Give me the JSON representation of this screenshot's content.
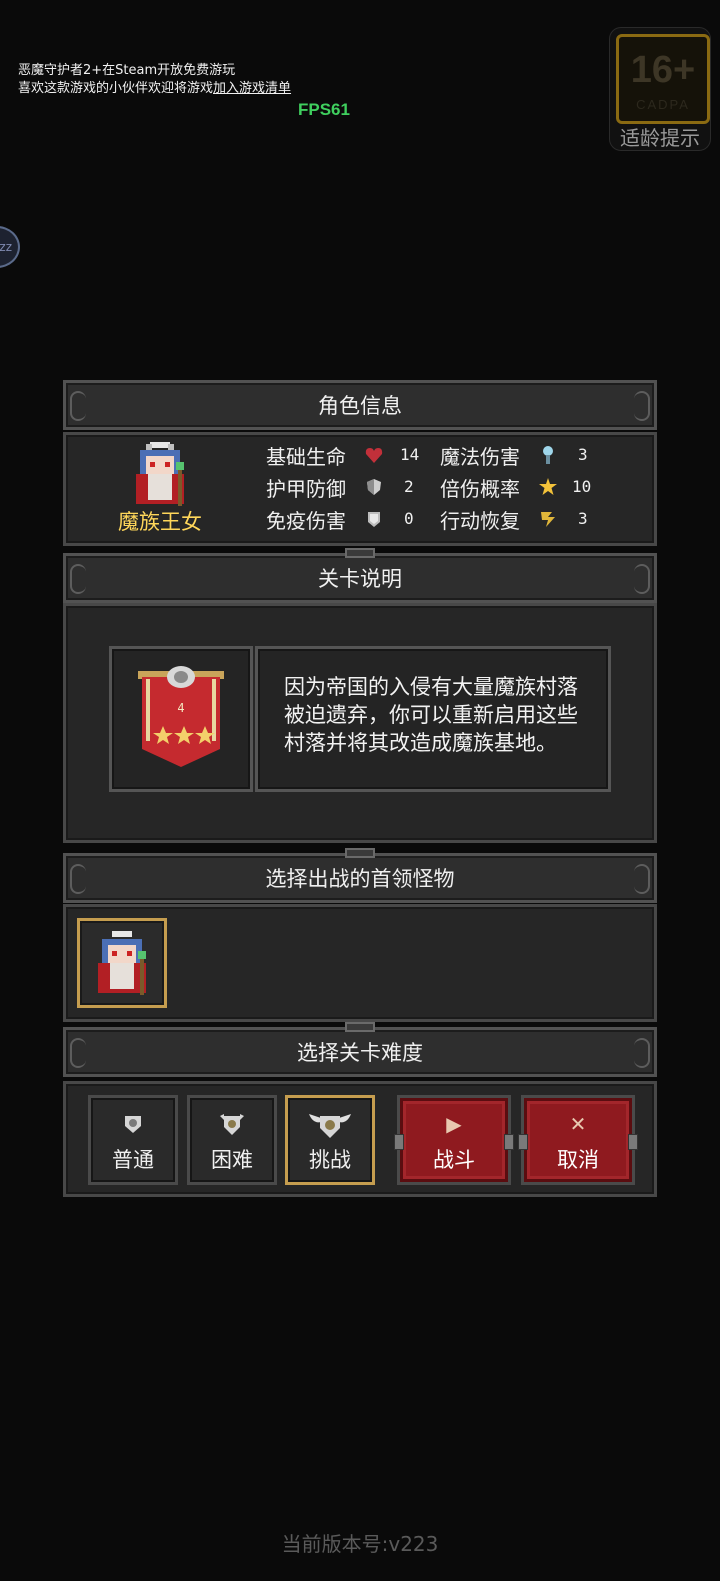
{
  "notice": {
    "line1": "恶魔守护者2+在Steam开放免费游玩",
    "line2_prefix": "喜欢这款游戏的小伙伴欢迎将游戏",
    "line2_link": "加入游戏清单"
  },
  "fps": "FPS61",
  "age_rating": {
    "number": "16+",
    "tag": "CADPA",
    "caption": "适龄提示"
  },
  "side_bubble": "zz",
  "character_panel": {
    "title": "角色信息",
    "name": "魔族王女",
    "stats": [
      {
        "label": "基础生命",
        "icon": "heart-icon",
        "value": "14"
      },
      {
        "label": "护甲防御",
        "icon": "armor-shield-icon",
        "value": "2"
      },
      {
        "label": "免疫伤害",
        "icon": "immunity-shield-icon",
        "value": "0"
      },
      {
        "label": "魔法伤害",
        "icon": "magic-staff-icon",
        "value": "3"
      },
      {
        "label": "倍伤概率",
        "icon": "crit-star-icon",
        "value": "10"
      },
      {
        "label": "行动恢复",
        "icon": "action-recover-icon",
        "value": "3"
      }
    ]
  },
  "level_panel": {
    "title": "关卡说明",
    "level_number": "4",
    "stars": 3,
    "description": "因为帝国的入侵有大量魔族村落被迫遗弃，你可以重新启用这些村落并将其改造成魔族基地。"
  },
  "boss_panel": {
    "title": "选择出战的首领怪物"
  },
  "difficulty_panel": {
    "title": "选择关卡难度",
    "options": [
      {
        "label": "普通",
        "selected": false
      },
      {
        "label": "困难",
        "selected": false
      },
      {
        "label": "挑战",
        "selected": true
      }
    ],
    "fight_label": "战斗",
    "cancel_label": "取消"
  },
  "colors": {
    "accent_gold": "#c59d4f",
    "button_red": "#8f1a1f",
    "name_yellow": "#ffd75a",
    "fps_green": "#3fcf5e"
  },
  "version": "当前版本号:v223"
}
